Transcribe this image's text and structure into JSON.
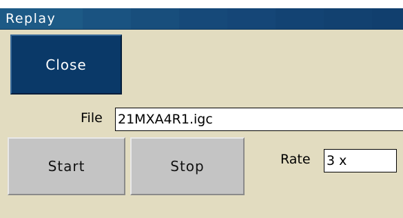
{
  "window": {
    "title": "Replay",
    "colors": {
      "titlebar": "#1d5a86",
      "background": "#e2dcc0",
      "close_button": "#0a3968",
      "gray_button": "#c4c4c4"
    }
  },
  "buttons": {
    "close_label": "Close",
    "start_label": "Start",
    "stop_label": "Stop"
  },
  "file": {
    "label": "File",
    "value": "21MXA4R1.igc"
  },
  "rate": {
    "label": "Rate",
    "value": "3 x"
  }
}
